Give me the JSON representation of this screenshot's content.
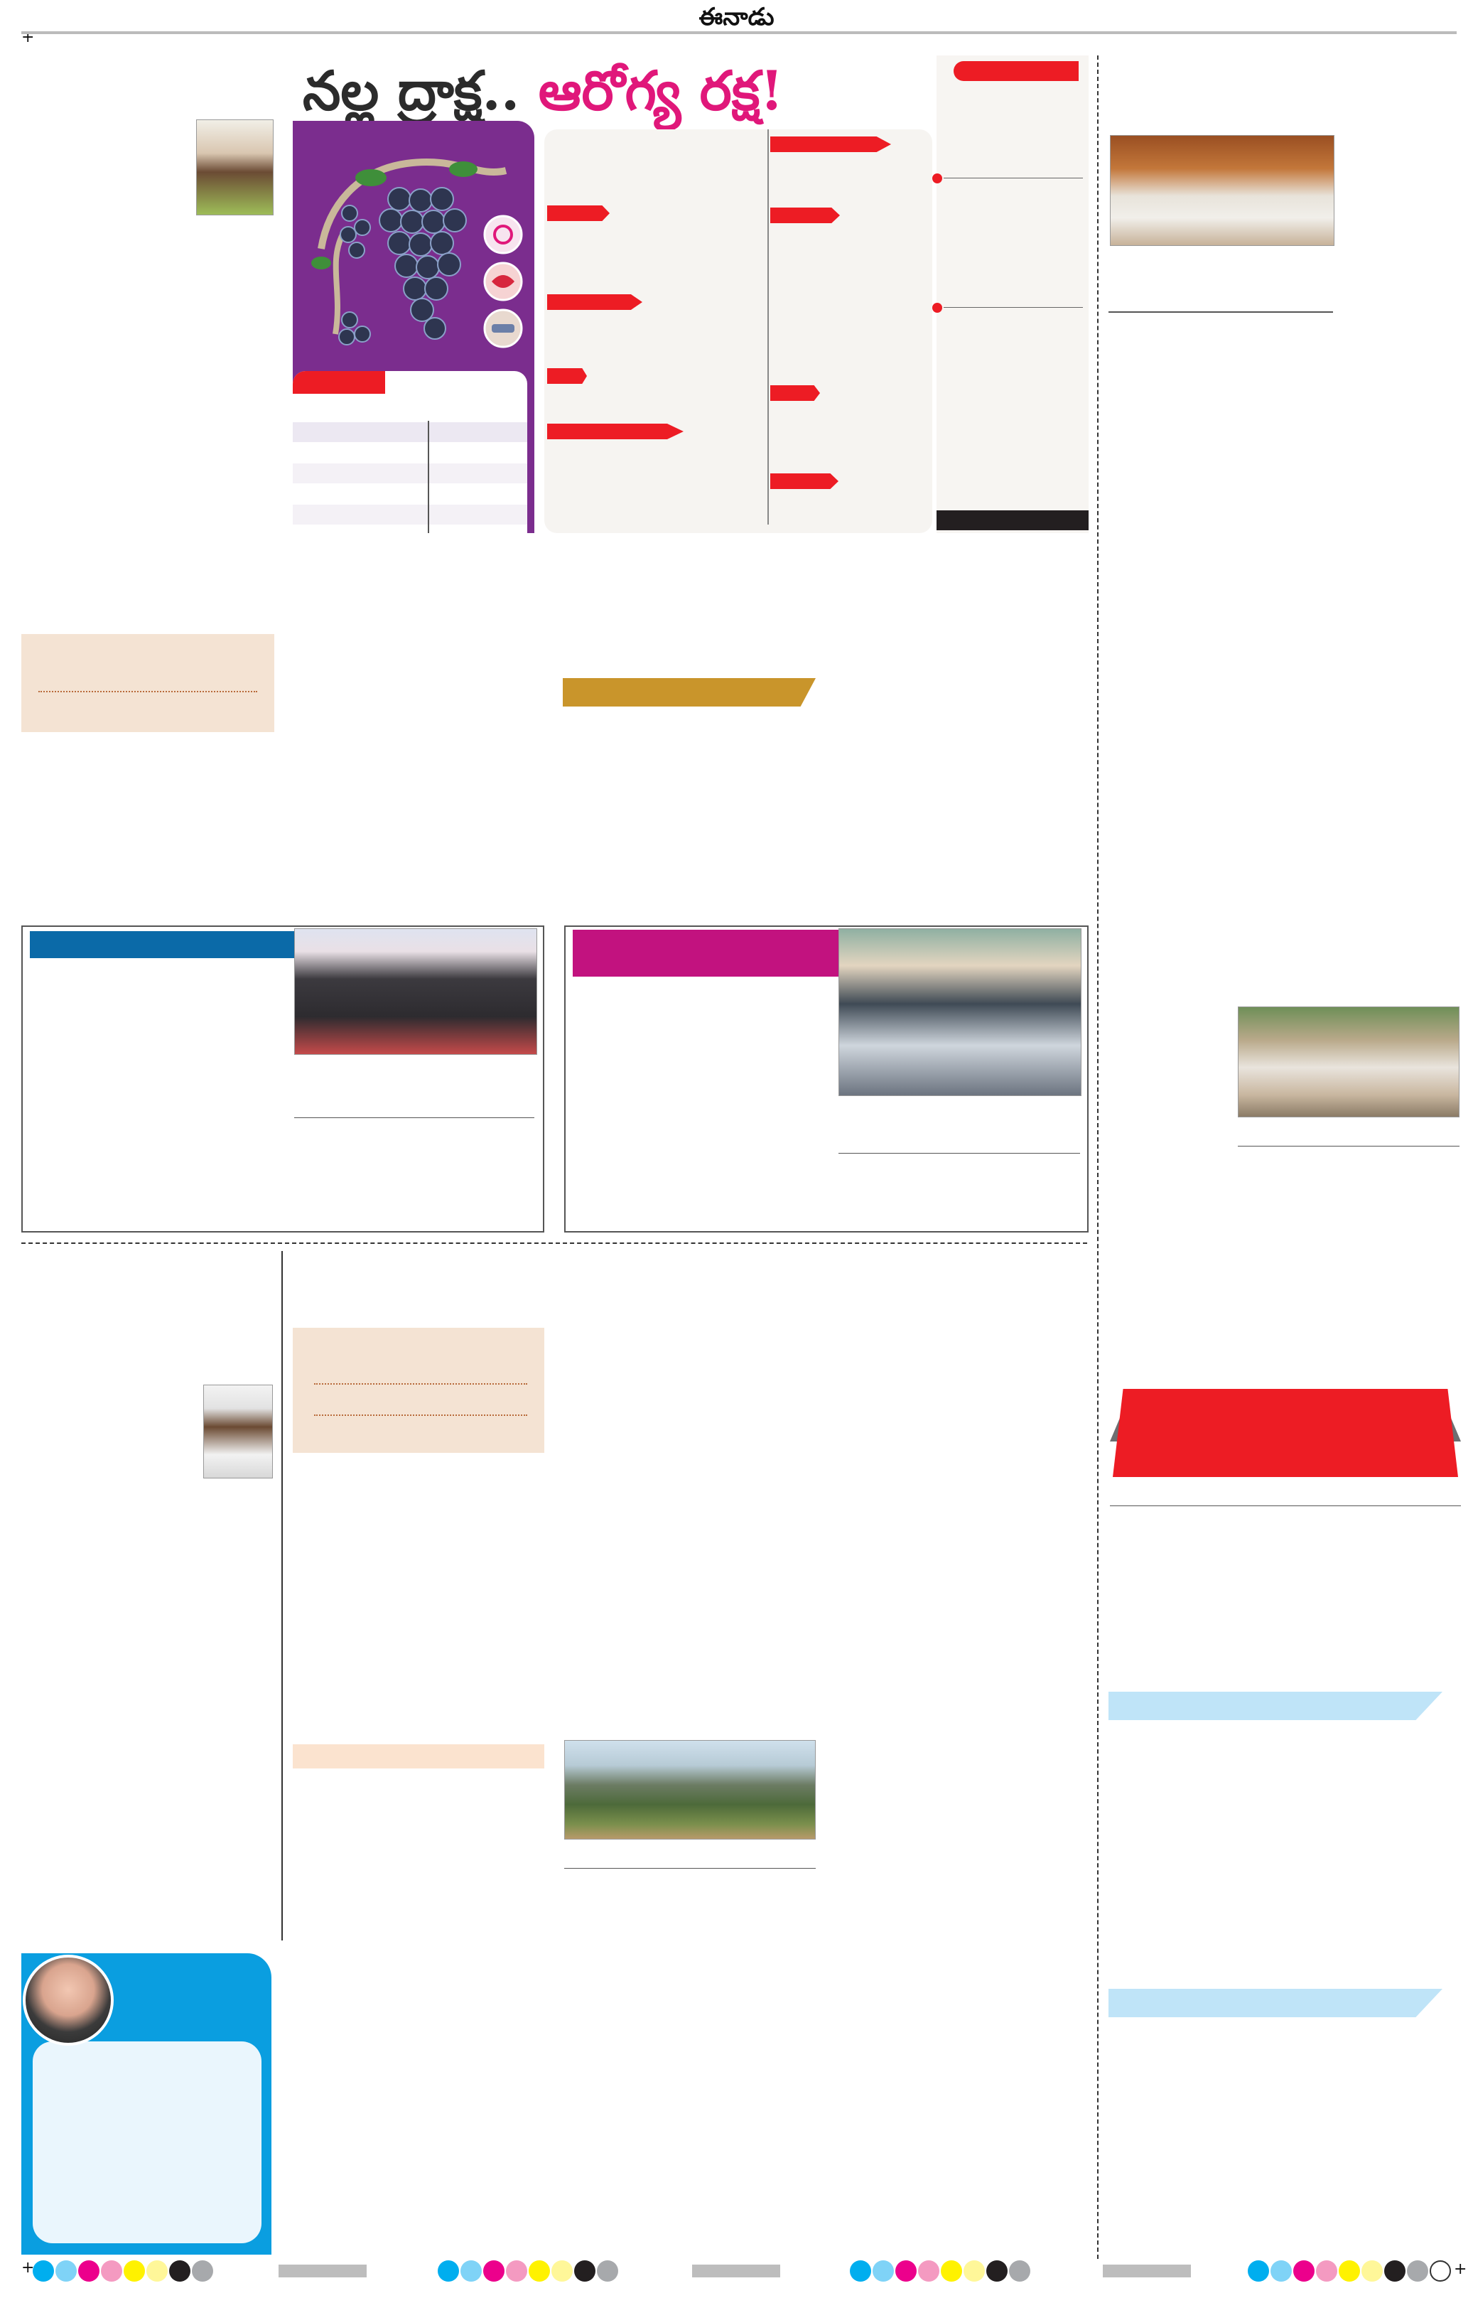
{
  "masthead": {
    "title": "ఈనాడు"
  },
  "feature": {
    "headline_part1": "నల్ల ద్రాక్ష..",
    "headline_part2": "ఆరోగ్య రక్ష!"
  },
  "colors": {
    "headline_dark": "#2b2b2b",
    "headline_pink": "#e0177a",
    "purple_panel": "#7b2d8e",
    "red_tag": "#ed1c24",
    "beige_box": "#f4e3d3",
    "gold_banner": "#c9952b",
    "blue_box_header": "#0b6aa8",
    "magenta_box_header": "#c2127f",
    "light_blue_tab": "#bfe4f8",
    "columnist_blue": "#0a9ee0"
  },
  "registration_swatches": [
    "#00aeef",
    "#7fd3f7",
    "#ec008c",
    "#f49ac1",
    "#fff200",
    "#fff799",
    "#231f20",
    "#a7a9ac"
  ],
  "icons": [
    "registration-mark",
    "registration-mark"
  ]
}
